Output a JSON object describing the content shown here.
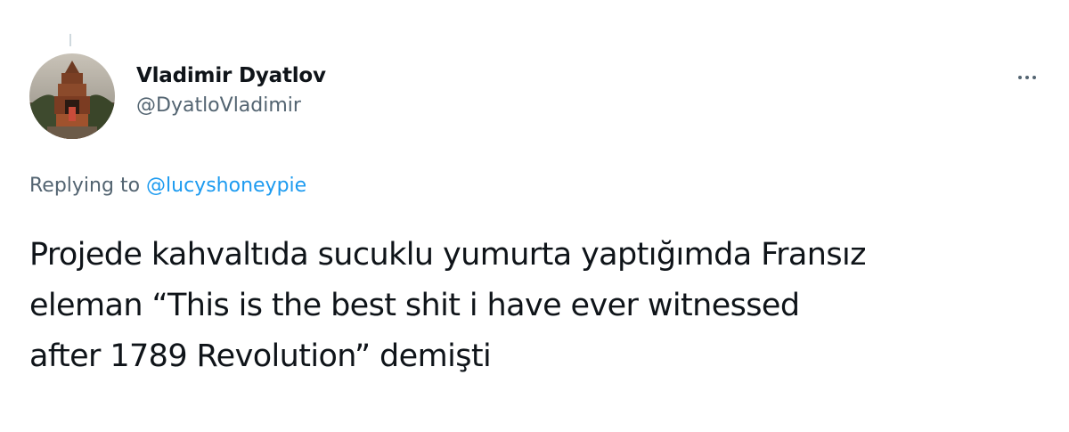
{
  "tweet": {
    "author": {
      "display_name": "Vladimir Dyatlov",
      "handle": "@DyatloVladimir",
      "avatar_icon": "profile-photo-temple"
    },
    "more_icon": "ellipsis-icon",
    "replying_to": {
      "prefix": "Replying to",
      "mention": "@lucyshoneypie"
    },
    "text_lines": [
      "Projede kahvaltıda sucuklu yumurta yaptığımda Fransız",
      "eleman “This is the best shit i have ever witnessed",
      "after 1789 Revolution” demişti"
    ]
  },
  "colors": {
    "text_primary": "#0f1419",
    "text_secondary": "#536471",
    "link": "#1d9bf0",
    "thread_line": "#cfd9de",
    "background": "#ffffff"
  }
}
